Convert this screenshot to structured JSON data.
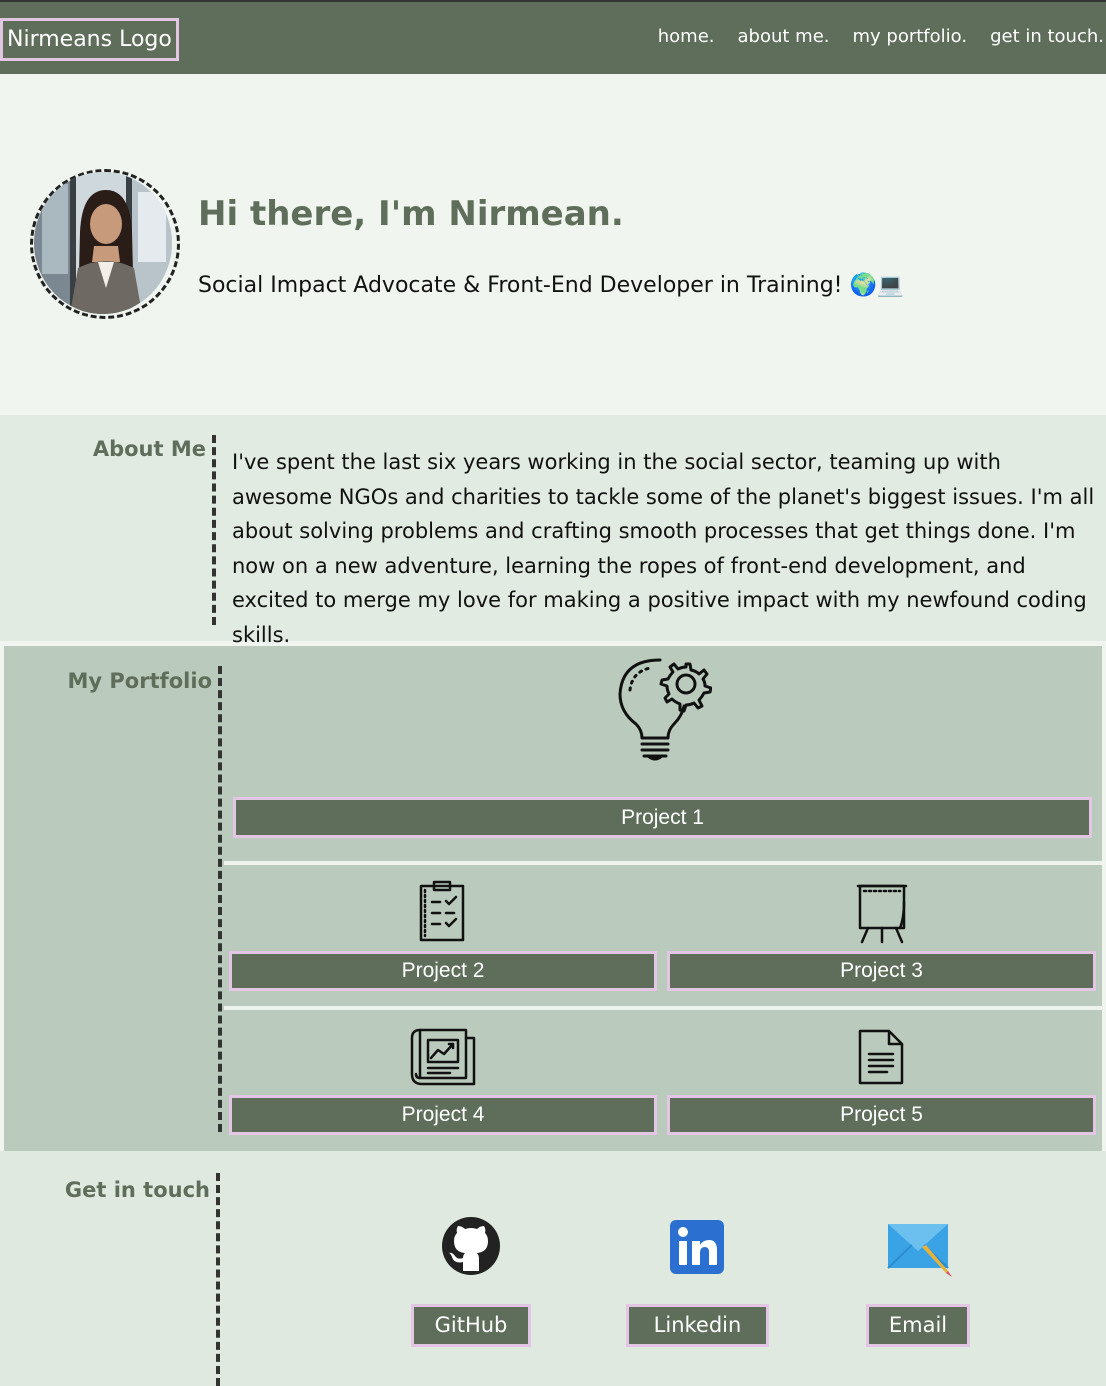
{
  "nav": {
    "logo": "Nirmeans Logo",
    "links": [
      "home.",
      "about me.",
      "my portfolio.",
      "get in touch."
    ]
  },
  "hero": {
    "title": "Hi there, I'm Nirmean.",
    "subtitle": "Social Impact Advocate & Front-End Developer in Training! 🌍💻"
  },
  "about": {
    "heading": "About Me",
    "text": "I've spent the last six years working in the social sector, teaming up with awesome NGOs and charities to tackle some of the planet's biggest issues. I'm all about solving problems and crafting smooth processes that get things done. I'm now on a new adventure, learning the ropes of front-end development, and excited to merge my love for making a positive impact with my newfound coding skills."
  },
  "portfolio": {
    "heading": "My Portfolio",
    "projects": [
      {
        "label": "Project 1",
        "icon": "lightbulb-gear-icon"
      },
      {
        "label": "Project 2",
        "icon": "clipboard-checklist-icon"
      },
      {
        "label": "Project 3",
        "icon": "flipchart-easel-icon"
      },
      {
        "label": "Project 4",
        "icon": "chart-document-icon"
      },
      {
        "label": "Project 5",
        "icon": "text-document-icon"
      }
    ]
  },
  "contact": {
    "heading": "Get in touch",
    "links": [
      {
        "label": "GitHub",
        "icon": "github-icon"
      },
      {
        "label": "Linkedin",
        "icon": "linkedin-icon"
      },
      {
        "label": "Email",
        "icon": "email-icon"
      }
    ]
  },
  "colors": {
    "nav_bg": "#5f6e5a",
    "accent_border": "#e3c6e4",
    "page_bg": "#f0f6ef",
    "about_bg": "#e1ebe1",
    "portfolio_bg": "#bacbbd",
    "heading_green": "#5f6e5a"
  }
}
